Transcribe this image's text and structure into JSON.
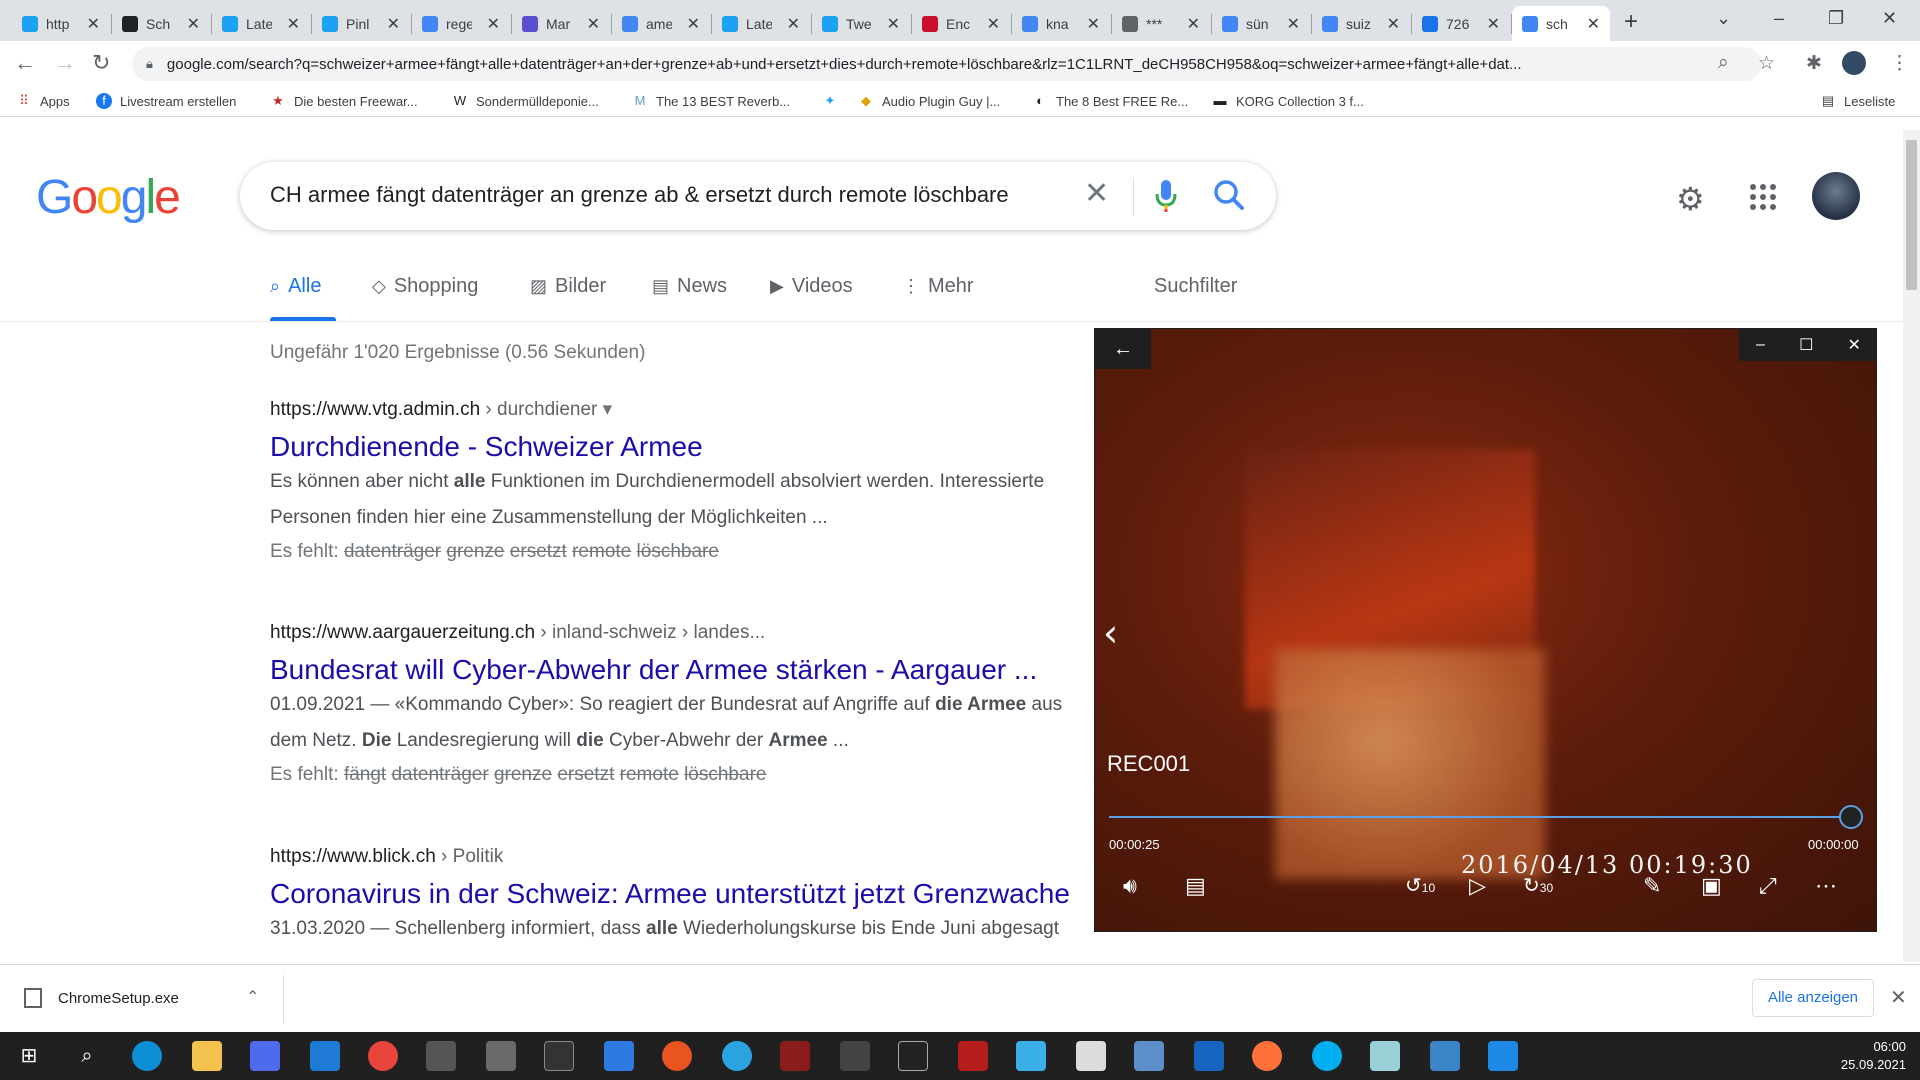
{
  "browser": {
    "tabs": [
      {
        "title": "http",
        "icon": "twitter-icon",
        "color": "#1da1f2"
      },
      {
        "title": "Sch",
        "icon": "chess-icon",
        "color": "#202124"
      },
      {
        "title": "Late",
        "icon": "twitter-icon",
        "color": "#1da1f2"
      },
      {
        "title": "Pinl",
        "icon": "twitter-icon",
        "color": "#1da1f2"
      },
      {
        "title": "rege",
        "icon": "google-icon",
        "color": "#4285f4"
      },
      {
        "title": "Mar",
        "icon": "mastodon-icon",
        "color": "#5a4fcf"
      },
      {
        "title": "ame",
        "icon": "google-icon",
        "color": "#4285f4"
      },
      {
        "title": "Late",
        "icon": "twitter-icon",
        "color": "#1da1f2"
      },
      {
        "title": "Twe",
        "icon": "twitter-box-icon",
        "color": "#1da1f2"
      },
      {
        "title": "Enc",
        "icon": "srf-icon",
        "color": "#c8102e"
      },
      {
        "title": "kna",
        "icon": "google-icon",
        "color": "#4285f4"
      },
      {
        "title": "***",
        "icon": "globe-icon",
        "color": "#5f6368"
      },
      {
        "title": "sün",
        "icon": "google-icon",
        "color": "#4285f4"
      },
      {
        "title": "suiz",
        "icon": "google-icon",
        "color": "#4285f4"
      },
      {
        "title": "726",
        "icon": "doc-icon",
        "color": "#1a73e8"
      },
      {
        "title": "sch",
        "icon": "google-icon",
        "color": "#4285f4",
        "active": true
      }
    ],
    "url": "google.com/search?q=schweizer+armee+fängt+alle+datenträger+an+der+grenze+ab+und+ersetzt+dies+durch+remote+löschbare&rlz=1C1LRNT_deCH958CH958&oq=schweizer+armee+fängt+alle+dat...",
    "bookmarks": [
      {
        "label": "Apps",
        "icon": "apps-grid-icon"
      },
      {
        "label": "Livestream erstellen",
        "icon": "facebook-icon"
      },
      {
        "label": "Die besten Freewar...",
        "icon": "star-icon"
      },
      {
        "label": "Sondermülldeponie...",
        "icon": "w-icon"
      },
      {
        "label": "The 13 BEST Reverb...",
        "icon": "m-logo-icon"
      },
      {
        "label": "",
        "icon": "twitter-icon"
      },
      {
        "label": "Audio Plugin Guy |...",
        "icon": "plugin-icon"
      },
      {
        "label": "The 8 Best FREE Re...",
        "icon": "moon-icon"
      },
      {
        "label": "KORG Collection 3 f...",
        "icon": "korg-icon"
      }
    ],
    "reading_list": "Leseliste"
  },
  "google": {
    "logo": "Google",
    "query": "CH armee fängt datenträger an grenze ab & ersetzt durch remote löschbare",
    "tabs": [
      {
        "label": "Alle",
        "icon": "search-icon",
        "selected": true
      },
      {
        "label": "Shopping",
        "icon": "tag-icon"
      },
      {
        "label": "Bilder",
        "icon": "image-icon"
      },
      {
        "label": "News",
        "icon": "news-icon"
      },
      {
        "label": "Videos",
        "icon": "video-icon"
      },
      {
        "label": "Mehr",
        "icon": "more-vert-icon"
      }
    ],
    "filter_label": "Suchfilter",
    "stats": "Ungefähr 1'020 Ergebnisse (0.56 Sekunden)",
    "results": [
      {
        "site": "https://www.vtg.admin.ch",
        "path": " › durchdiener",
        "title": "Durchdienende - Schweizer Armee",
        "snippet1": "Es können aber nicht <b>alle</b> Funktionen im Durchdienermodell absolviert werden. Interessierte",
        "snippet2": "Personen finden hier eine Zusammenstellung der Möglichkeiten ...",
        "missing_label": "Es fehlt:",
        "missing": [
          "datenträger",
          "grenze",
          "ersetzt",
          "remote",
          "löschbare"
        ]
      },
      {
        "site": "https://www.aargauerzeitung.ch",
        "path": " › inland-schweiz › landes...",
        "title": "Bundesrat will Cyber-Abwehr der Armee stärken - Aargauer ...",
        "snippet1": "01.09.2021 — «Kommando Cyber»: So reagiert der Bundesrat auf Angriffe auf <b>die Armee</b> aus",
        "snippet2": "dem Netz. <b>Die</b> Landesregierung will <b>die</b> Cyber-Abwehr der <b>Armee</b> ...",
        "missing_label": "Es fehlt:",
        "missing": [
          "fängt",
          "datenträger",
          "grenze",
          "ersetzt",
          "remote",
          "löschbare"
        ]
      },
      {
        "site": "https://www.blick.ch",
        "path": " › Politik",
        "title": "Coronavirus in der Schweiz: Armee unterstützt jetzt Grenzwache",
        "snippet1": "31.03.2020 — Schellenberg informiert, dass <b>alle</b> Wiederholungskurse bis Ende Juni abgesagt",
        "snippet2": "",
        "missing_label": "",
        "missing": []
      }
    ]
  },
  "player": {
    "name": "REC001",
    "position": "00:00:25",
    "duration": "00:00:00",
    "progress": 1.0,
    "osd_timestamp": "2016/04/13  00:19:30",
    "skip_back": "10",
    "skip_forward": "30"
  },
  "downloads": {
    "file": "ChromeSetup.exe",
    "show_all": "Alle anzeigen"
  },
  "taskbar": {
    "time": "06:00",
    "date": "25.09.2021"
  }
}
